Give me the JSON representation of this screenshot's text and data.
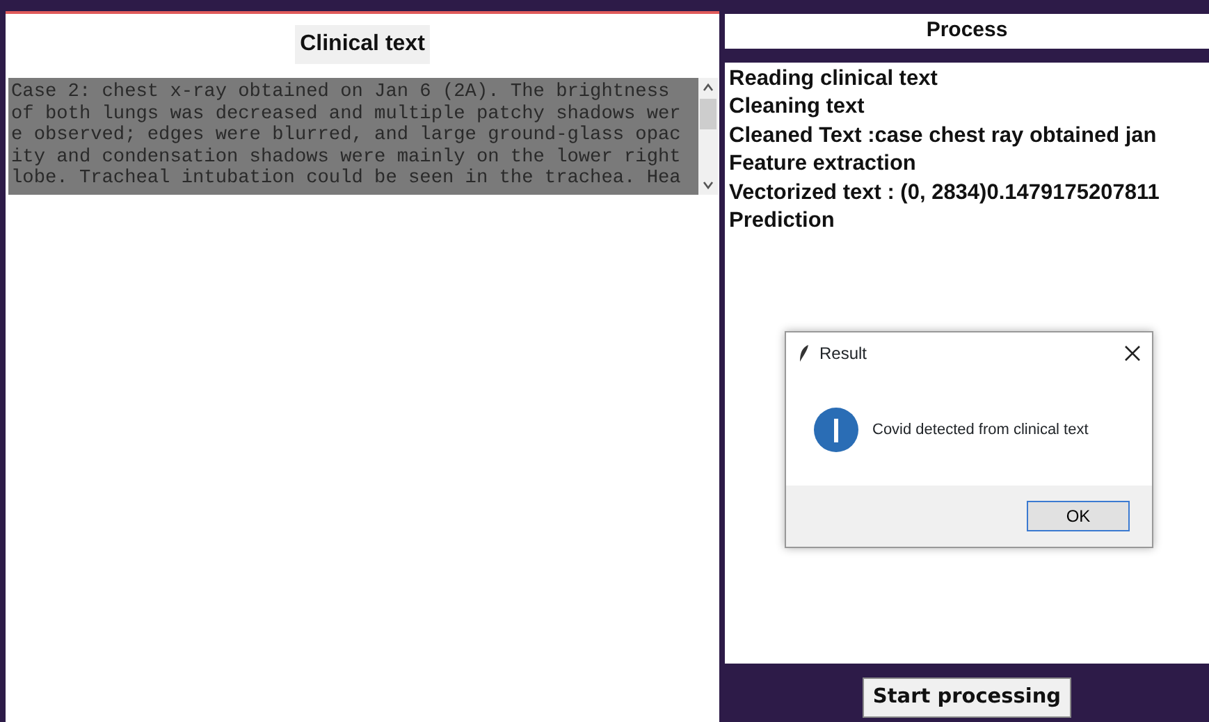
{
  "clinical_panel": {
    "title": "Clinical text",
    "text_lines": [
      "Case 2: chest x-ray obtained on Jan 6 (2A). The brightness",
      "of both lungs was decreased and multiple patchy shadows wer",
      "e observed; edges were blurred, and large ground-glass opac",
      "ity and condensation shadows were mainly on the lower right",
      "lobe. Tracheal intubation could be seen in the trachea. Hea"
    ],
    "text_selected": true
  },
  "process_panel": {
    "title": "Process",
    "log": [
      "Reading clinical text",
      "Cleaning text",
      "Cleaned Text :case chest ray obtained jan",
      "Feature extraction",
      "Vectorized text :  (0, 2834)0.1479175207811",
      "Prediction"
    ],
    "button": "Start processing"
  },
  "dialog": {
    "title": "Result",
    "message": "Covid detected from clinical text",
    "button": "OK"
  }
}
